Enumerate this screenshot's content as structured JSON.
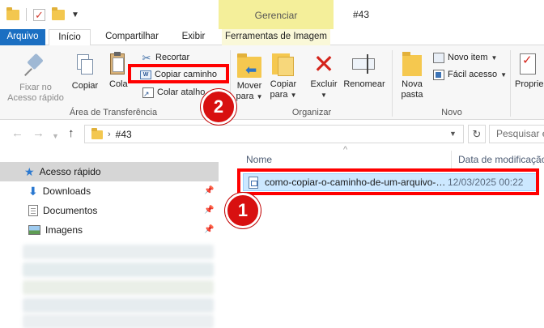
{
  "window": {
    "title": "#43",
    "context_tab_header": "Gerenciar"
  },
  "tabs": [
    {
      "label": "Arquivo"
    },
    {
      "label": "Início"
    },
    {
      "label": "Compartilhar"
    },
    {
      "label": "Exibir"
    },
    {
      "label": "Ferramentas de Imagem"
    }
  ],
  "ribbon": {
    "clipboard": {
      "pin_line1": "Fixar no",
      "pin_line2": "Acesso rápido",
      "copy": "Copiar",
      "paste": "Cola",
      "cut": "Recortar",
      "copy_path": "Copiar caminho",
      "paste_shortcut": "Colar atalho",
      "group_label": "Área de Transferência"
    },
    "organize": {
      "move_line1": "Mover",
      "move_line2": "para",
      "copy_line1": "Copiar",
      "copy_line2": "para",
      "delete": "Excluir",
      "rename": "Renomear",
      "group_label": "Organizar"
    },
    "new": {
      "folder_line1": "Nova",
      "folder_line2": "pasta",
      "new_item": "Novo item",
      "easy_access": "Fácil acesso",
      "group_label": "Novo"
    },
    "open": {
      "properties": "Proprie"
    }
  },
  "address": {
    "path": "#43",
    "search_placeholder": "Pesquisar em"
  },
  "nav": {
    "quick_access": "Acesso rápido",
    "items": [
      {
        "label": "Downloads"
      },
      {
        "label": "Documentos"
      },
      {
        "label": "Imagens"
      }
    ]
  },
  "columns": {
    "name": "Nome",
    "date": "Data de modificação"
  },
  "files": [
    {
      "name": "como-copiar-o-caminho-de-um-arquivo-no-windows",
      "date": "12/03/2025 00:22"
    }
  ],
  "annotations": {
    "badge1": "1",
    "badge2": "2",
    "color": "#ff0000"
  },
  "colors": {
    "file_tab": "#1b6fc2",
    "context_tab": "#f4ef9a",
    "selection": "#cce8ff",
    "highlight": "#ff0000"
  }
}
